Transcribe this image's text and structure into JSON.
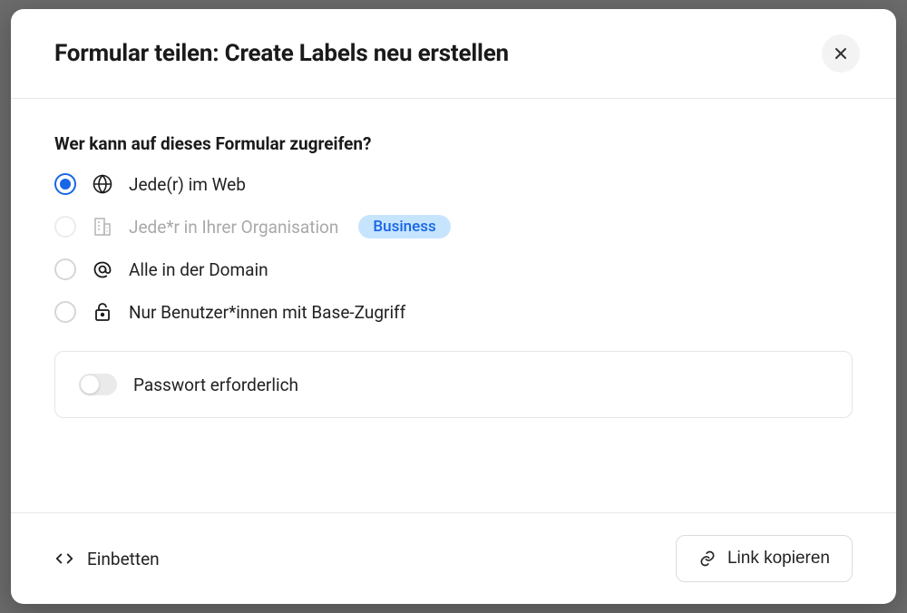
{
  "modal": {
    "title": "Formular teilen: Create Labels neu erstellen"
  },
  "access": {
    "heading": "Wer kann auf dieses Formular zugreifen?",
    "options": [
      {
        "label": "Jede(r) im Web",
        "icon": "globe",
        "selected": true,
        "disabled": false,
        "badge": null
      },
      {
        "label": "Jede*r in Ihrer Organisation",
        "icon": "building",
        "selected": false,
        "disabled": true,
        "badge": "Business"
      },
      {
        "label": "Alle in der Domain",
        "icon": "at-sign",
        "selected": false,
        "disabled": false,
        "badge": null
      },
      {
        "label": "Nur Benutzer*innen mit Base-Zugriff",
        "icon": "lock",
        "selected": false,
        "disabled": false,
        "badge": null
      }
    ]
  },
  "password": {
    "label": "Passwort erforderlich",
    "enabled": false
  },
  "footer": {
    "embed": "Einbetten",
    "copy": "Link kopieren"
  }
}
